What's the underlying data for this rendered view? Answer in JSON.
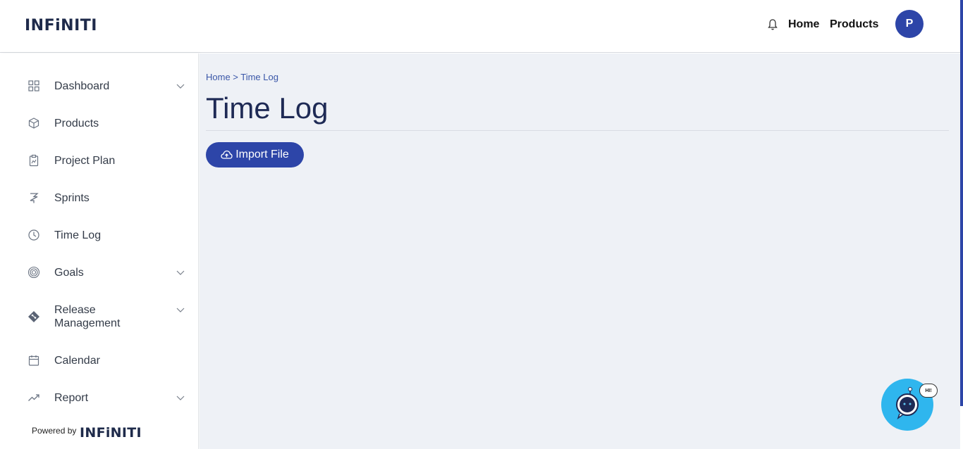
{
  "header": {
    "logo_text": "INFiNITI",
    "nav": {
      "home": "Home",
      "products": "Products"
    },
    "avatar_initial": "P"
  },
  "sidebar": {
    "items": [
      {
        "label": "Dashboard",
        "icon": "grid-icon",
        "has_chevron": true
      },
      {
        "label": "Products",
        "icon": "cube-icon",
        "has_chevron": false
      },
      {
        "label": "Project Plan",
        "icon": "clipboard-chart-icon",
        "has_chevron": false
      },
      {
        "label": "Sprints",
        "icon": "sprint-icon",
        "has_chevron": false
      },
      {
        "label": "Time Log",
        "icon": "clock-icon",
        "has_chevron": false
      },
      {
        "label": "Goals",
        "icon": "target-icon",
        "has_chevron": true
      },
      {
        "label": "Release Management",
        "icon": "git-diamond-icon",
        "has_chevron": true
      },
      {
        "label": "Calendar",
        "icon": "calendar-icon",
        "has_chevron": false
      },
      {
        "label": "Report",
        "icon": "trend-up-icon",
        "has_chevron": true
      }
    ],
    "powered_by": "Powered by",
    "powered_logo": "INFiNITI"
  },
  "main": {
    "breadcrumb": "Home > Time Log",
    "title": "Time Log",
    "import_button": "Import File"
  },
  "chatbot": {
    "bubble": "HI!"
  },
  "colors": {
    "primary": "#2d45a8",
    "title": "#1e2a55",
    "background": "#eef1f6",
    "chatbot": "#2fb6ee"
  }
}
